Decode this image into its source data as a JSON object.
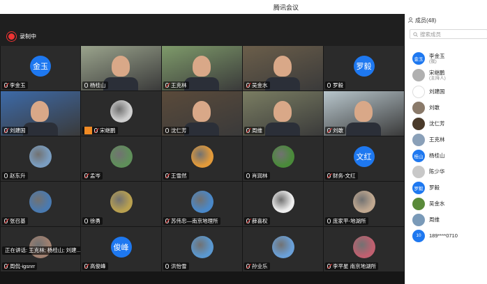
{
  "window": {
    "title": "腾讯会议"
  },
  "recording": {
    "label": "录制中"
  },
  "speaking": {
    "text": "正在讲话: 王克林; 杨桂山; 刘建..."
  },
  "tiles": [
    {
      "name": "李金玉",
      "avatar_text": "金玉",
      "type": "text-avatar"
    },
    {
      "name": "杨桂山",
      "type": "video",
      "scene": "#9aa38c"
    },
    {
      "name": "王克林",
      "type": "video",
      "scene": "#7e9a6a"
    },
    {
      "name": "吴金水",
      "type": "video",
      "scene": "#6b5e4a"
    },
    {
      "name": "罗毅",
      "avatar_text": "罗毅",
      "type": "text-avatar"
    },
    {
      "name": "刘建国",
      "type": "video",
      "scene": "#3d6aa8"
    },
    {
      "name": "宋继鹏",
      "type": "image-avatar",
      "host": true,
      "scene": "#cfcfcf"
    },
    {
      "name": "沈仁芳",
      "type": "video",
      "scene": "#5a4a3a"
    },
    {
      "name": "周维",
      "type": "video",
      "scene": "#7a7d62"
    },
    {
      "name": "刘敢",
      "type": "video",
      "scene": "#b8c6cc"
    },
    {
      "name": "赵东升",
      "type": "image-avatar",
      "scene": "#7a9dc0"
    },
    {
      "name": "孟岑",
      "type": "image-avatar",
      "scene": "#5f8f5a"
    },
    {
      "name": "王雪然",
      "type": "image-avatar",
      "scene": "#e29a3a"
    },
    {
      "name": "肖润林",
      "type": "image-avatar",
      "scene": "#4a8a3a"
    },
    {
      "name": "财务-文红",
      "avatar_text": "文红",
      "type": "text-avatar"
    },
    {
      "name": "张召基",
      "type": "image-avatar",
      "scene": "#4a7ab0"
    },
    {
      "name": "徐勇",
      "type": "image-avatar",
      "scene": "#b8a050"
    },
    {
      "name": "苏伟忠—南京地理所",
      "type": "image-avatar",
      "scene": "#4a88c8"
    },
    {
      "name": "薛喜权",
      "type": "image-avatar",
      "scene": "#eeeeee"
    },
    {
      "name": "庞家平-地湖所",
      "type": "image-avatar",
      "scene": "#c0a890"
    },
    {
      "name": "周侃-igsnrr",
      "type": "image-avatar",
      "scene": "#a08070"
    },
    {
      "name": "高俊峰",
      "avatar_text": "俊峰",
      "type": "text-avatar"
    },
    {
      "name": "洪怡雪",
      "type": "image-avatar",
      "scene": "#5a98d0"
    },
    {
      "name": "孙业乐",
      "type": "image-avatar",
      "scene": "#6aa0d8"
    },
    {
      "name": "李平星 南京地湖所",
      "type": "image-avatar",
      "scene": "#c06070"
    }
  ],
  "sidebar": {
    "title": "成员(48)",
    "search_placeholder": "搜索成员",
    "members": [
      {
        "name": "李金玉",
        "sub": "(我)",
        "avatar_text": "金玉",
        "color": "#1e78f0"
      },
      {
        "name": "宋继鹏",
        "sub": "(主持人)",
        "avatar_text": "",
        "color": "#b0b0b0"
      },
      {
        "name": "刘建国",
        "sub": "",
        "avatar_text": "",
        "color": "#ffffff"
      },
      {
        "name": "刘敢",
        "sub": "",
        "avatar_text": "",
        "color": "#8a7a6a"
      },
      {
        "name": "沈仁芳",
        "sub": "",
        "avatar_text": "",
        "color": "#4a3a2a"
      },
      {
        "name": "王克林",
        "sub": "",
        "avatar_text": "",
        "color": "#8aa0b8"
      },
      {
        "name": "杨桂山",
        "sub": "",
        "avatar_text": "桂山",
        "color": "#1e78f0"
      },
      {
        "name": "陈少华",
        "sub": "",
        "avatar_text": "",
        "color": "#c8c8c8"
      },
      {
        "name": "罗毅",
        "sub": "",
        "avatar_text": "罗毅",
        "color": "#1e78f0"
      },
      {
        "name": "吴金水",
        "sub": "",
        "avatar_text": "",
        "color": "#5a8a3a"
      },
      {
        "name": "周维",
        "sub": "",
        "avatar_text": "",
        "color": "#7a9ab8"
      },
      {
        "name": "189****0710",
        "sub": "",
        "avatar_text": "10",
        "color": "#1e78f0"
      }
    ]
  }
}
